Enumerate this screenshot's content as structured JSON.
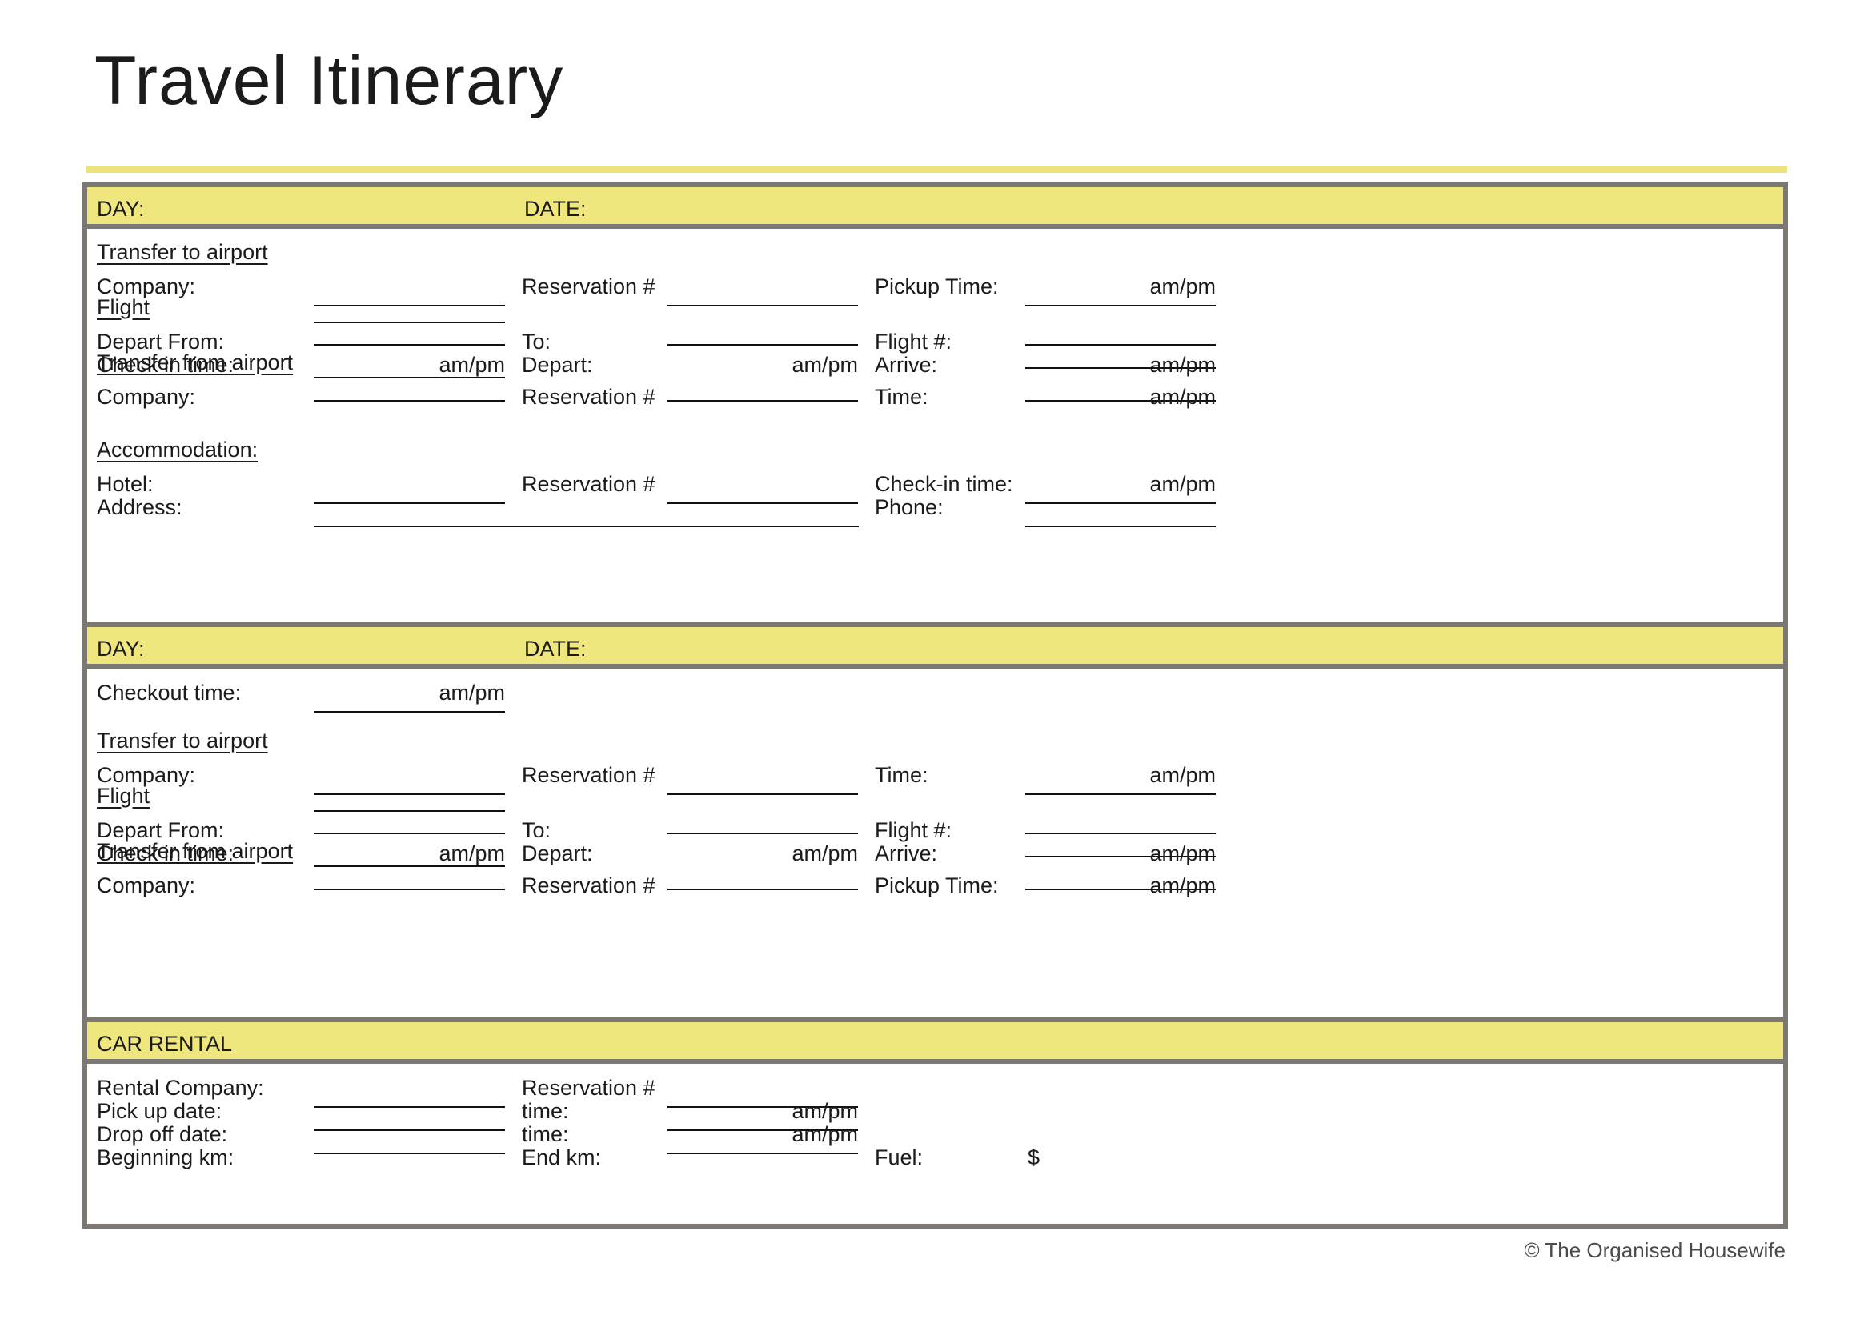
{
  "document": {
    "title": "Travel Itinerary",
    "footer_credit": "© The Organised Housewife",
    "accent_color": "#f0e67e",
    "border_color": "#7b7873",
    "line_color": "#111111"
  },
  "labels": {
    "day": "DAY:",
    "date": "DATE:",
    "car_rental": "CAR RENTAL",
    "transfer_to_airport": "Transfer to airport",
    "transfer_from_airport": "Transfer from airport",
    "flight": "Flight",
    "accommodation": "Accommodation:",
    "company": "Company:",
    "reservation": "Reservation #",
    "pickup_time": "Pickup Time:",
    "time": "Time:",
    "depart_from": "Depart From:",
    "to": "To:",
    "flight_number": "Flight #:",
    "check_in_time": "Check in time:",
    "depart": "Depart:",
    "arrive": "Arrive:",
    "hotel": "Hotel:",
    "check_in_time_hotel": "Check-in time:",
    "address": "Address:",
    "phone": "Phone:",
    "checkout_time": "Checkout time:",
    "rental_company": "Rental Company:",
    "pick_up_date": "Pick up date:",
    "drop_off_date": "Drop off date:",
    "time_lower": "time:",
    "beginning_km": "Beginning km:",
    "end_km": "End km:",
    "fuel": "Fuel:",
    "ampm": "am/pm",
    "currency": "$"
  }
}
